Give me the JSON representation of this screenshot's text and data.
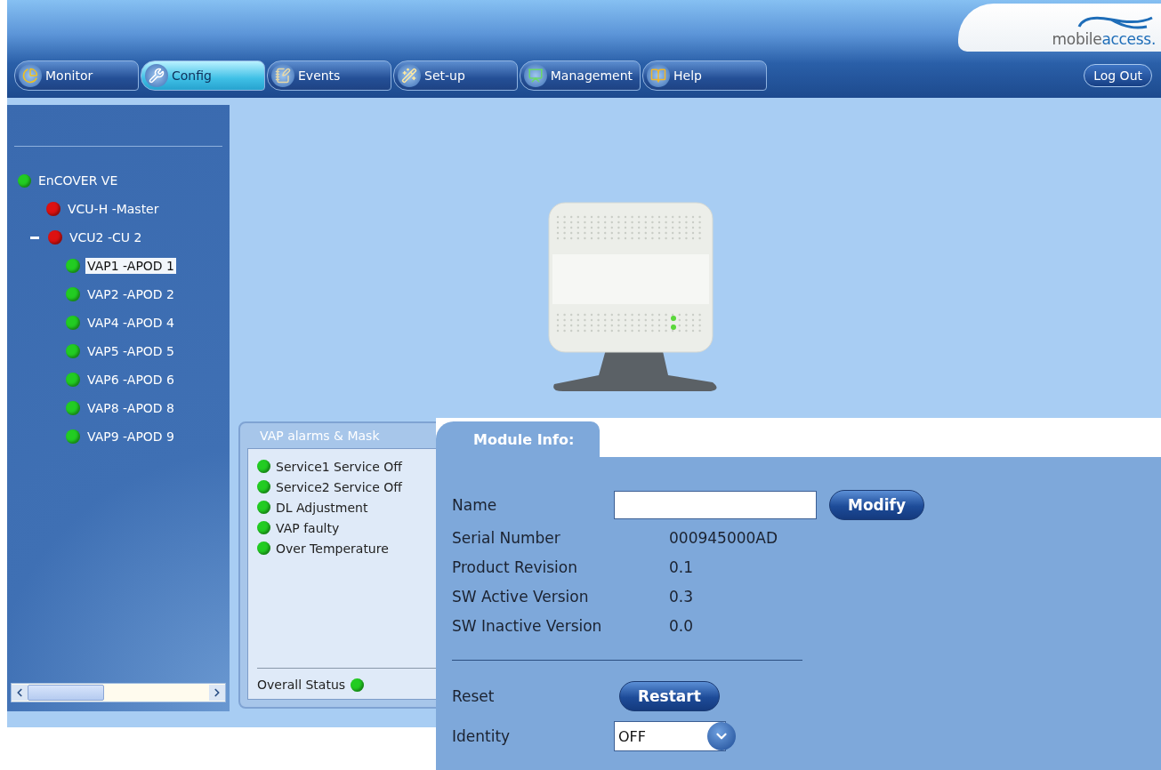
{
  "logo": {
    "prefix": "mobile",
    "suffix": "access."
  },
  "tabs": [
    {
      "label": "Monitor",
      "kind": "monitor",
      "selected": false
    },
    {
      "label": "Config",
      "kind": "config",
      "selected": true
    },
    {
      "label": "Events",
      "kind": "events",
      "selected": false
    },
    {
      "label": "Set-up",
      "kind": "setup",
      "selected": false
    },
    {
      "label": "Management",
      "kind": "management",
      "selected": false
    },
    {
      "label": "Help",
      "kind": "help",
      "selected": false
    }
  ],
  "logout": "Log Out",
  "tree": [
    {
      "label": "EnCOVER VE",
      "color": "#22cc22",
      "selected": false,
      "children": [
        {
          "label": "VCU-H -Master",
          "color": "#dd1111",
          "selected": false
        },
        {
          "label": "VCU2 -CU 2",
          "color": "#dd1111",
          "selected": false,
          "expanded": true,
          "children": [
            {
              "label": "VAP1 -APOD 1",
              "color": "#22cc22",
              "selected": true
            },
            {
              "label": "VAP2 -APOD 2",
              "color": "#22cc22",
              "selected": false
            },
            {
              "label": "VAP4 -APOD 4",
              "color": "#22cc22",
              "selected": false
            },
            {
              "label": "VAP5 -APOD 5",
              "color": "#22cc22",
              "selected": false
            },
            {
              "label": "VAP6 -APOD 6",
              "color": "#22cc22",
              "selected": false
            },
            {
              "label": "VAP8 -APOD 8",
              "color": "#22cc22",
              "selected": false
            },
            {
              "label": "VAP9 -APOD 9",
              "color": "#22cc22",
              "selected": false
            }
          ]
        }
      ]
    }
  ],
  "alarms": {
    "title": "VAP alarms & Mask",
    "items": [
      {
        "label": "Service1 Service Off",
        "color": "#22cc22"
      },
      {
        "label": "Service2 Service Off",
        "color": "#22cc22"
      },
      {
        "label": "DL Adjustment",
        "color": "#22cc22"
      },
      {
        "label": "VAP faulty",
        "color": "#22cc22"
      },
      {
        "label": "Over Temperature",
        "color": "#22cc22"
      }
    ],
    "overall": {
      "label": "Overall Status",
      "color": "#22cc22"
    }
  },
  "module": {
    "tab": "Module Info:",
    "name": {
      "label": "Name",
      "button": "Modify"
    },
    "info": [
      {
        "label": "Serial Number",
        "value": "000945000AD"
      },
      {
        "label": "Product Revision",
        "value": "0.1"
      },
      {
        "label": "SW Active Version",
        "value": "0.3"
      },
      {
        "label": "SW Inactive Version",
        "value": "0.0"
      }
    ],
    "reset": {
      "label": "Reset",
      "button": "Restart"
    },
    "identity": {
      "label": "Identity",
      "value": "OFF"
    }
  }
}
